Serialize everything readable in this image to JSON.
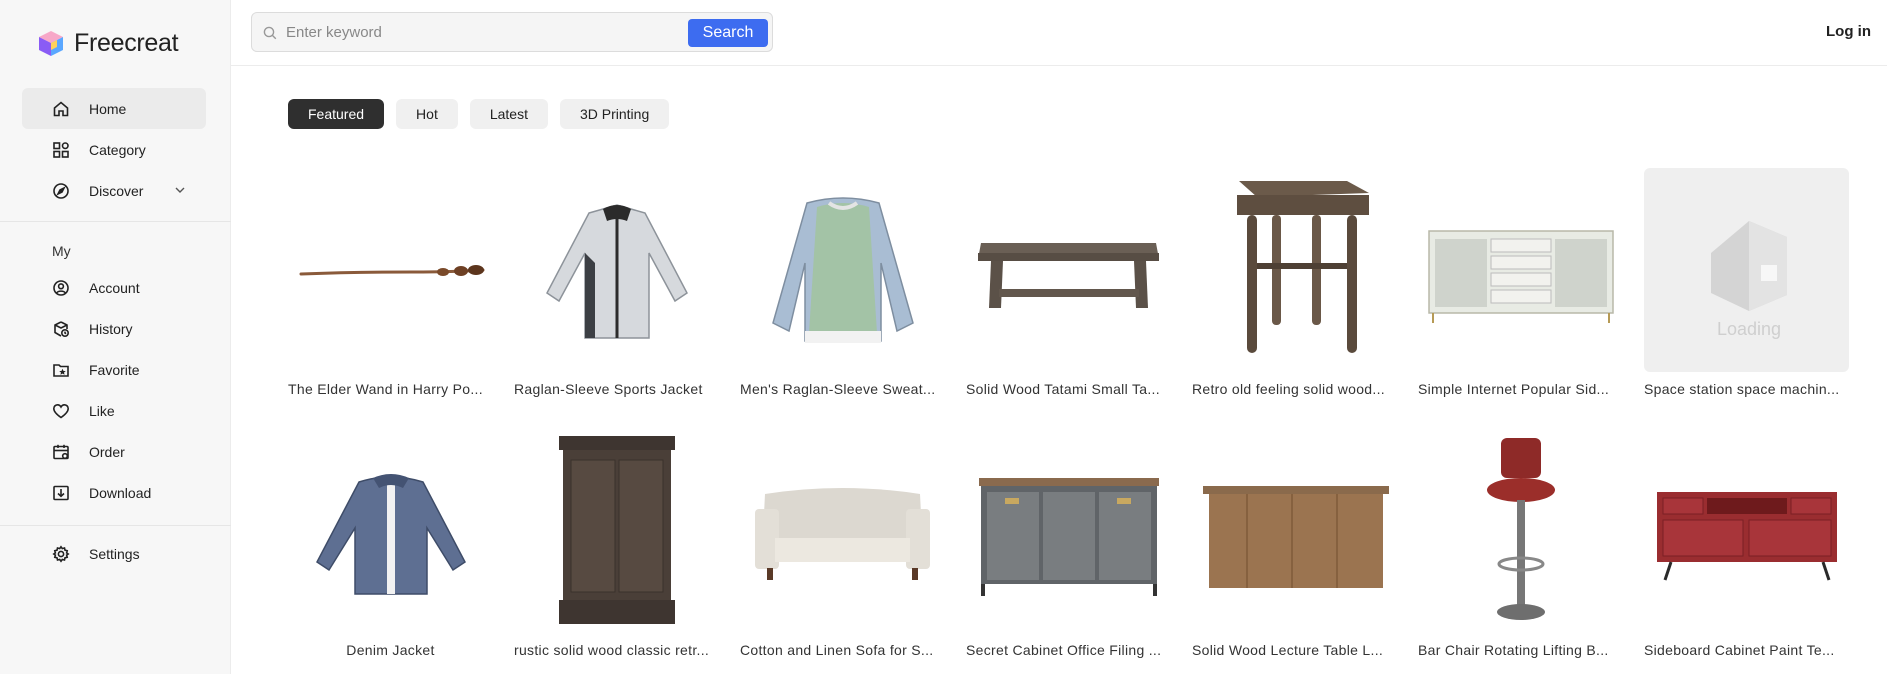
{
  "app": {
    "name": "Freecreat"
  },
  "colors": {
    "accent": "#3d6cf0",
    "active_tab": "#2f2f2f",
    "sidebar_bg": "#f7f7f7"
  },
  "sidebar": {
    "main": [
      {
        "label": "Home",
        "icon": "home-icon",
        "active": true
      },
      {
        "label": "Category",
        "icon": "category-icon"
      },
      {
        "label": "Discover",
        "icon": "compass-icon",
        "expandable": true
      }
    ],
    "my_label": "My",
    "my": [
      {
        "label": "Account",
        "icon": "account-icon"
      },
      {
        "label": "History",
        "icon": "history-icon"
      },
      {
        "label": "Favorite",
        "icon": "folder-star-icon"
      },
      {
        "label": "Like",
        "icon": "heart-icon"
      },
      {
        "label": "Order",
        "icon": "calendar-icon"
      },
      {
        "label": "Download",
        "icon": "download-icon"
      }
    ],
    "bottom": [
      {
        "label": "Settings",
        "icon": "gear-icon"
      }
    ]
  },
  "header": {
    "search_placeholder": "Enter keyword",
    "search_value": "",
    "search_button": "Search",
    "login": "Log in"
  },
  "tabs": [
    {
      "label": "Featured",
      "active": true
    },
    {
      "label": "Hot"
    },
    {
      "label": "Latest"
    },
    {
      "label": "3D Printing"
    }
  ],
  "items": [
    {
      "title": "The Elder Wand in Harry Po...",
      "thumb": "wand"
    },
    {
      "title": "Raglan-Sleeve Sports Jacket",
      "thumb": "jacket"
    },
    {
      "title": "Men's Raglan-Sleeve Sweat...",
      "thumb": "sweatshirt"
    },
    {
      "title": "Solid Wood Tatami Small Ta...",
      "thumb": "tatami-table"
    },
    {
      "title": "Retro old feeling solid wood...",
      "thumb": "side-table"
    },
    {
      "title": "Simple Internet Popular Sid...",
      "thumb": "sideboard-white"
    },
    {
      "title": "Space station space machin...",
      "thumb": "loading",
      "loading_text": "Loading"
    },
    {
      "title": "Denim Jacket",
      "thumb": "denim-jacket"
    },
    {
      "title": "rustic solid wood classic retr...",
      "thumb": "wardrobe"
    },
    {
      "title": "Cotton and Linen Sofa for S...",
      "thumb": "sofa"
    },
    {
      "title": "Secret Cabinet Office Filing ...",
      "thumb": "filing-cabinet"
    },
    {
      "title": "Solid Wood Lecture Table L...",
      "thumb": "lecture-table"
    },
    {
      "title": "Bar Chair Rotating Lifting B...",
      "thumb": "bar-chair"
    },
    {
      "title": "Sideboard Cabinet Paint Te...",
      "thumb": "red-sideboard"
    }
  ]
}
